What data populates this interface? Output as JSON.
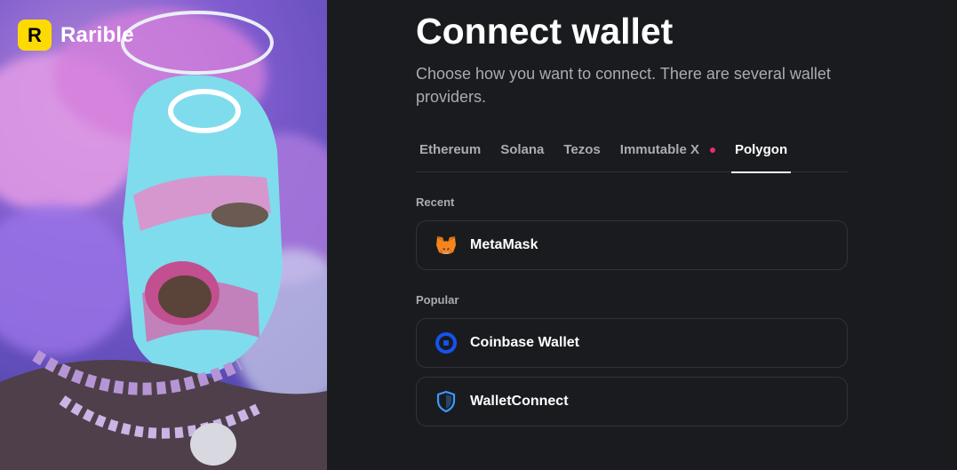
{
  "brand": {
    "mark_letter": "R",
    "name": "Rarible",
    "mark_color": "#feda03"
  },
  "page": {
    "title": "Connect wallet",
    "subtitle": "Choose how you want to connect. There are several wallet providers."
  },
  "tabs": [
    {
      "label": "Ethereum",
      "active": false
    },
    {
      "label": "Solana",
      "active": false
    },
    {
      "label": "Tezos",
      "active": false
    },
    {
      "label": "Immutable X",
      "active": false,
      "has_badge_dot": true
    },
    {
      "label": "Polygon",
      "active": true
    }
  ],
  "sections": {
    "recent": {
      "label": "Recent",
      "wallets": [
        {
          "name": "MetaMask",
          "icon": "metamask-fox-icon"
        }
      ]
    },
    "popular": {
      "label": "Popular",
      "wallets": [
        {
          "name": "Coinbase Wallet",
          "icon": "coinbase-icon"
        },
        {
          "name": "WalletConnect",
          "icon": "walletconnect-shield-icon"
        }
      ]
    }
  },
  "colors": {
    "background": "#191b1e",
    "accent_dot": "#f0286e",
    "coinbase_blue": "#1652f0",
    "muted_text": "#a8acb3"
  }
}
